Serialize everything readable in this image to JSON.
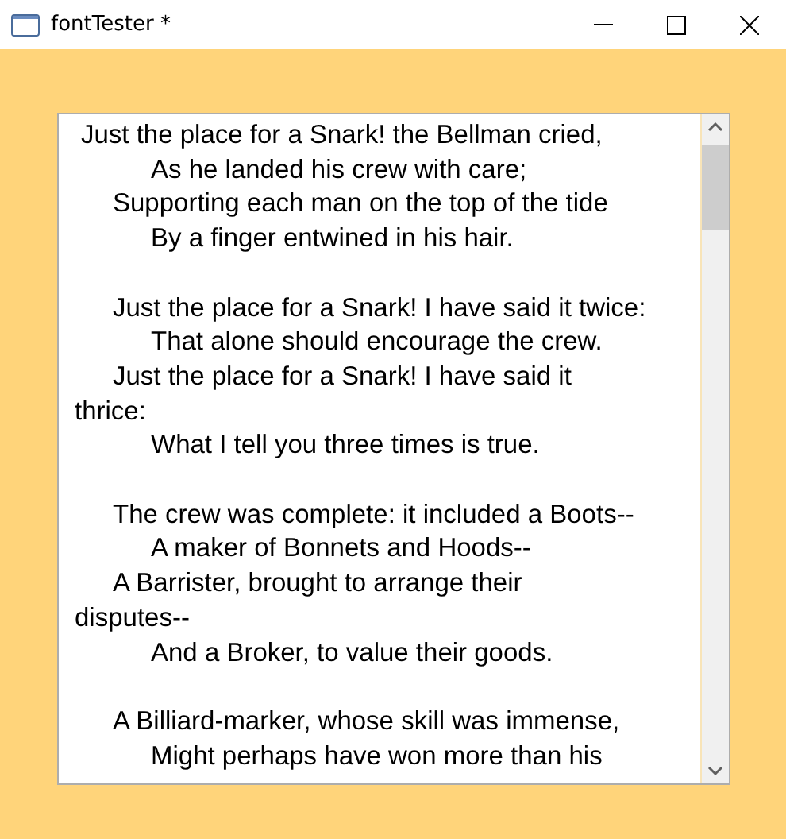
{
  "window": {
    "title": "fontTester *"
  },
  "text_area": {
    "stanzas": [
      {
        "lines": [
          {
            "kind": "lead",
            "text": "Just the place for a Snark! the Bellman cried,"
          },
          {
            "kind": "deep",
            "text": "As he landed his crew with care;"
          },
          {
            "kind": "indent",
            "text": "Supporting each man on the top of the tide"
          },
          {
            "kind": "deep",
            "text": "By a finger entwined in his hair."
          }
        ]
      },
      {
        "lines": [
          {
            "kind": "indent",
            "text": "Just the place for a Snark! I have said it twice:"
          },
          {
            "kind": "deep",
            "text": "That alone should encourage the crew."
          },
          {
            "kind": "indent",
            "text": "Just the place for a Snark! I have said it"
          },
          {
            "kind": "wrap",
            "text": "thrice:"
          },
          {
            "kind": "deep",
            "text": "What I tell you three times is true."
          }
        ]
      },
      {
        "lines": [
          {
            "kind": "indent",
            "text": "The crew was complete: it included a Boots--"
          },
          {
            "kind": "deep",
            "text": "A maker of Bonnets and Hoods--"
          },
          {
            "kind": "indent",
            "text": "A Barrister, brought to arrange their"
          },
          {
            "kind": "wrap",
            "text": "disputes--"
          },
          {
            "kind": "deep",
            "text": "And a Broker, to value their goods."
          }
        ]
      },
      {
        "lines": [
          {
            "kind": "indent",
            "text": "A Billiard-marker, whose skill was immense,"
          },
          {
            "kind": "deep",
            "text": "Might perhaps have won more than his"
          }
        ]
      }
    ]
  }
}
